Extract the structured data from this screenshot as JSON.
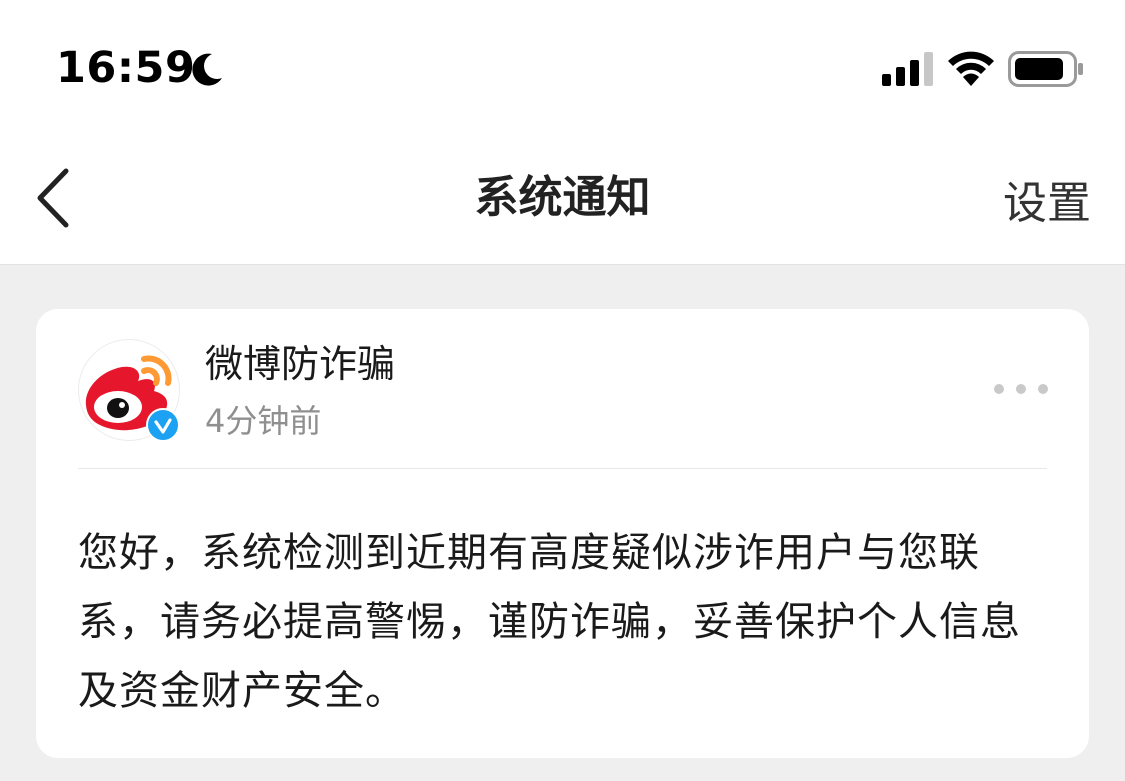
{
  "status_bar": {
    "time": "16:59",
    "moon_icon": "moon-icon",
    "signal_icon": "cellular-signal-icon",
    "wifi_icon": "wifi-icon",
    "battery_icon": "battery-icon"
  },
  "nav": {
    "back_icon": "chevron-left-icon",
    "title": "系统通知",
    "settings_label": "设置"
  },
  "notification": {
    "sender": "微博防诈骗",
    "time_ago": "4分钟前",
    "verified_icon": "verified-badge-icon",
    "more_icon": "more-dots-icon",
    "message": "您好，系统检测到近期有高度疑似涉诈用户与您联系，请务必提高警惕，谨防诈骗，妥善保护个人信息及资金财产安全。"
  },
  "colors": {
    "page_background": "#efefef",
    "card_background": "#ffffff",
    "weibo_red": "#e6162d",
    "weibo_orange": "#ff9933",
    "verified_blue": "#1da1f2",
    "secondary_text": "#8f8f8f"
  }
}
